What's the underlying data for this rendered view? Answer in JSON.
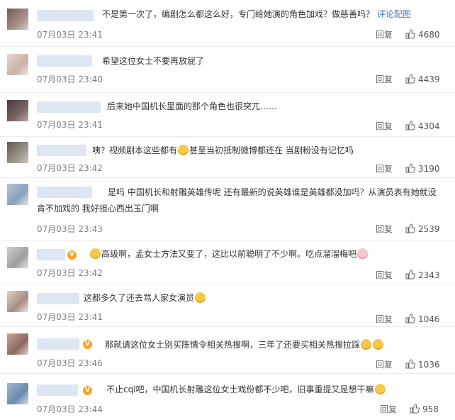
{
  "comments": [
    {
      "text": "不是第一次了，编剧怎么都这么好，专门给她演的角色加戏？做慈善吗？",
      "link": "评论配图",
      "time": "07月03日 23:41",
      "reply": "回复",
      "likes": "4680"
    },
    {
      "text": "希望这位女士不要再放屁了",
      "time": "07月03日 23:40",
      "reply": "回复",
      "likes": "4439"
    },
    {
      "text": "后来她中国机长里面的那个角色也很突兀……",
      "time": "07月03日 23:41",
      "reply": "回复",
      "likes": "4304"
    },
    {
      "text1": "咦？视频剧本这些都有",
      "text2": "甚至当初抵制微博都还在 当剧粉没有记忆吗",
      "time": "07月03日 23:42",
      "reply": "回复",
      "likes": "3190"
    },
    {
      "line1": "是吗 中国机长和射雕英雄传呢 还有最新的说英雄谁是英雄都没加吗？从演员表有她就没",
      "line2": "肯不加戏的 我好担心西出玉门啊",
      "time": "07月03日 23:43",
      "reply": "回复",
      "likes": "2539"
    },
    {
      "text": "高级啊，孟女士方法又变了，这比以前聪明了不少啊。吃点溜溜梅吧",
      "time": "07月03日 23:42",
      "reply": "回复",
      "likes": "2343"
    },
    {
      "text": "这都多久了还去骂人家女演员",
      "time": "07月03日 23:41",
      "reply": "回复",
      "likes": "1046"
    },
    {
      "text": "那就请这位女士别买陈情令相关热搜啊，三年了还要买相关热搜拉踩",
      "time": "07月03日 23:46",
      "reply": "回复",
      "likes": "1036"
    },
    {
      "text": "不止cql吧，中国机长射雕这位女士戏份都不少吧，旧事重提又是想干嘛",
      "time": "07月03日 23:44",
      "reply": "回复",
      "likes": "958"
    }
  ],
  "badge_letter": "V"
}
